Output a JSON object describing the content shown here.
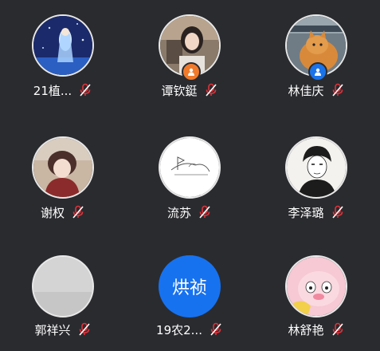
{
  "participants": [
    {
      "name": "21植...",
      "avatar": "anime-girl-night-avatar",
      "muted": true,
      "host": false
    },
    {
      "name": "谭钦鋌",
      "avatar": "girl-photo-avatar",
      "muted": true,
      "host": true,
      "host_color": "#f07a2a"
    },
    {
      "name": "林佳庆",
      "avatar": "cat-photo-avatar",
      "muted": true,
      "host": true,
      "host_color": "#1a73e8"
    },
    {
      "name": "谢权",
      "avatar": "anime-boy-avatar",
      "muted": true,
      "host": false
    },
    {
      "name": "流苏",
      "avatar": "sketch-avatar",
      "muted": true,
      "host": false
    },
    {
      "name": "李泽璐",
      "avatar": "manga-boy-avatar",
      "muted": true,
      "host": false
    },
    {
      "name": "郭祥兴",
      "avatar": "gray-avatar",
      "muted": true,
      "host": false
    },
    {
      "name": "19农2...",
      "avatar_text": "烘祯",
      "avatar_color": "#1772f0",
      "muted": true,
      "host": false
    },
    {
      "name": "林舒艳",
      "avatar": "cartoon-pig-avatar",
      "muted": true,
      "host": false
    }
  ],
  "colors": {
    "background": "#2a2b2f",
    "mic_muted": "#e0323a"
  }
}
